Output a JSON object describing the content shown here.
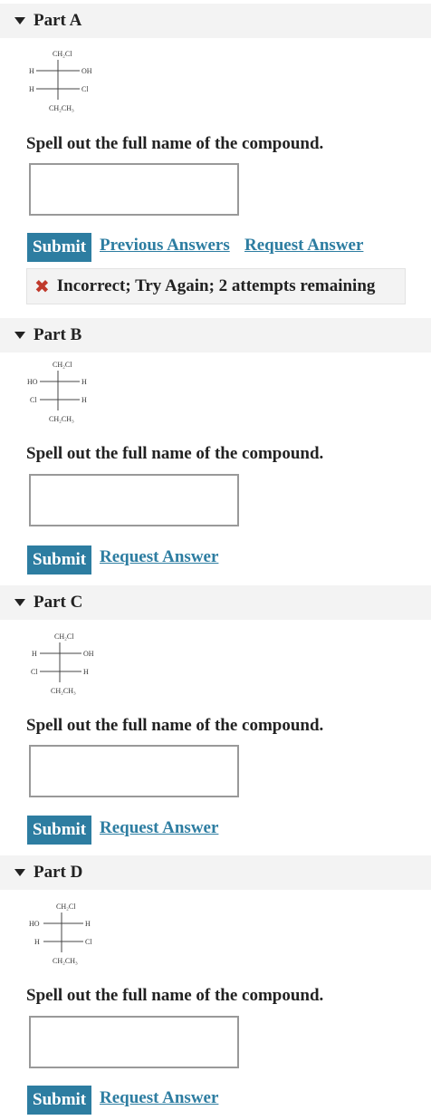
{
  "parts": [
    {
      "title": "Part A",
      "prompt": "Spell out the full name of the compound.",
      "answer_value": "",
      "submit_label": "Submit",
      "links": [
        "Previous Answers",
        "Request Answer"
      ],
      "feedback": "Incorrect; Try Again; 2 attempts remaining",
      "fischer": {
        "top": "CH₂Cl",
        "row1_left": "H",
        "row1_right": "OH",
        "row2_left": "H",
        "row2_right": "Cl",
        "bottom": "CH₂CH₃"
      }
    },
    {
      "title": "Part B",
      "prompt": "Spell out the full name of the compound.",
      "answer_value": "",
      "submit_label": "Submit",
      "links": [
        "Request Answer"
      ],
      "fischer": {
        "top": "CH₂Cl",
        "row1_left": "HO",
        "row1_right": "H",
        "row2_left": "Cl",
        "row2_right": "H",
        "bottom": "CH₂CH₃"
      }
    },
    {
      "title": "Part C",
      "prompt": "Spell out the full name of the compound.",
      "answer_value": "",
      "submit_label": "Submit",
      "links": [
        "Request Answer"
      ],
      "fischer": {
        "top": "CH₂Cl",
        "row1_left": "H",
        "row1_right": "OH",
        "row2_left": "Cl",
        "row2_right": "H",
        "bottom": "CH₂CH₃"
      }
    },
    {
      "title": "Part D",
      "prompt": "Spell out the full name of the compound.",
      "answer_value": "",
      "submit_label": "Submit",
      "links": [
        "Request Answer"
      ],
      "fischer": {
        "top": "CH₂Cl",
        "row1_left": "HO",
        "row1_right": "H",
        "row2_left": "H",
        "row2_right": "Cl",
        "bottom": "CH₂CH₃"
      }
    }
  ],
  "colors": {
    "accent": "#2d7da1",
    "error": "#c0392b",
    "header_bg": "#f3f3f3"
  },
  "icons": {
    "collapse": "caret-down-icon",
    "error": "x-icon"
  }
}
